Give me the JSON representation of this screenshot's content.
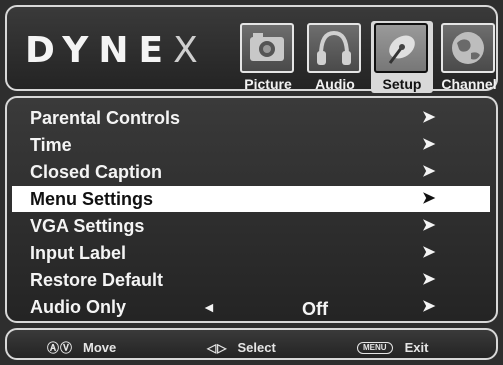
{
  "brand": {
    "letters": "DYNE",
    "x": "X"
  },
  "tabs": [
    {
      "label": "Picture",
      "icon": "camera-icon"
    },
    {
      "label": "Audio",
      "icon": "headphones-icon"
    },
    {
      "label": "Setup",
      "icon": "satellite-dish-icon",
      "active": true
    },
    {
      "label": "Channel",
      "icon": "globe-icon"
    }
  ],
  "menu": {
    "items": [
      {
        "label": "Parental Controls",
        "arrow": "➤"
      },
      {
        "label": "Time",
        "arrow": "➤"
      },
      {
        "label": "Closed Caption",
        "arrow": "➤"
      },
      {
        "label": "Menu Settings",
        "arrow": "➤",
        "selected": true
      },
      {
        "label": "VGA Settings",
        "arrow": "➤"
      },
      {
        "label": "Input Label",
        "arrow": "➤"
      },
      {
        "label": "Restore Default",
        "arrow": "➤"
      },
      {
        "label": "Audio Only",
        "arrow": "➤",
        "left_arrow": "◄",
        "value": "Off"
      }
    ]
  },
  "footer": {
    "move": {
      "glyph": "ⒶⓋ",
      "label": "Move"
    },
    "select": {
      "glyph": "◁▷",
      "label": "Select"
    },
    "exit": {
      "key": "MENU",
      "label": "Exit"
    }
  },
  "colors": {
    "background": "#2e2e2e",
    "selected_row": "#ffffff",
    "text": "#f4f4f4"
  }
}
